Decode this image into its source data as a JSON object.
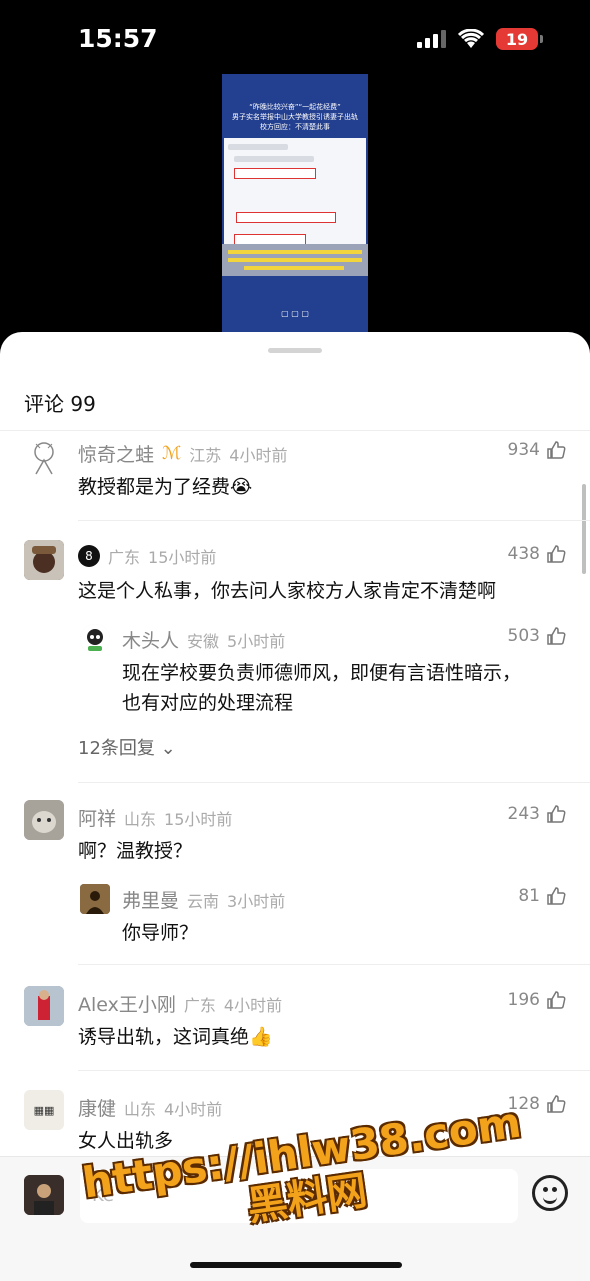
{
  "status": {
    "time": "15:57",
    "battery": "19"
  },
  "video": {
    "title": "“昨晚比较兴奋”“一起花经费”",
    "subtitle1": "男子实名举报中山大学教授引诱妻子出轨",
    "subtitle2": "校方回应：不清楚此事"
  },
  "sheet": {
    "title": "评论 99"
  },
  "comments": [
    {
      "name": "惊奇之蛙",
      "location": "江苏",
      "time": "4小时前",
      "likes": "934",
      "text": "教授都是为了经费😭"
    },
    {
      "name": "",
      "location": "广东",
      "time": "15小时前",
      "likes": "438",
      "text": "这是个人私事，你去问人家校方人家肯定不清楚啊",
      "reply": {
        "name": "木头人",
        "location": "安徽",
        "time": "5小时前",
        "likes": "503",
        "text1": "现在学校要负责师德师风，即便有言语性暗示，",
        "text2": "也有对应的处理流程"
      },
      "more": "12条回复"
    },
    {
      "name": "阿祥",
      "location": "山东",
      "time": "15小时前",
      "likes": "243",
      "text": "啊？温教授？",
      "reply": {
        "name": "弗里曼",
        "location": "云南",
        "time": "3小时前",
        "likes": "81",
        "text": "你导师？"
      }
    },
    {
      "name": "Alex王小刚",
      "location": "广东",
      "time": "4小时前",
      "likes": "196",
      "text": "诱导出轨，这词真绝👍"
    },
    {
      "name": "康健",
      "location": "山东",
      "time": "4小时前",
      "likes": "128",
      "text": "女人出轨多"
    }
  ],
  "composer": {
    "placeholder": "Ke"
  },
  "watermark": {
    "line1": "https://ihlw38.com",
    "line2": "黑料网"
  },
  "colors": {
    "accent": "#f2a21b",
    "battery": "#e53935",
    "video_bg": "#233f8f"
  }
}
